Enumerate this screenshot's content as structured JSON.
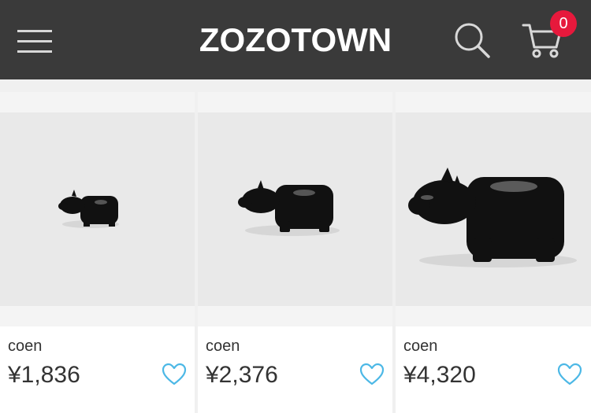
{
  "header": {
    "logo": "ZOZOTOWN",
    "cart_count": "0",
    "icons": [
      "hamburger-menu-icon",
      "search-icon",
      "cart-icon"
    ],
    "colors": {
      "bar": "#3a3a3a",
      "badge": "#e6193c",
      "heart": "#4cb8e6"
    }
  },
  "products": [
    {
      "brand": "coen",
      "price": "¥1,836",
      "image": "small black ceramic hippo figurine"
    },
    {
      "brand": "coen",
      "price": "¥2,376",
      "image": "medium black ceramic hippo figurine"
    },
    {
      "brand": "coen",
      "price": "¥4,320",
      "image": "large black ceramic hippo figurine"
    }
  ]
}
